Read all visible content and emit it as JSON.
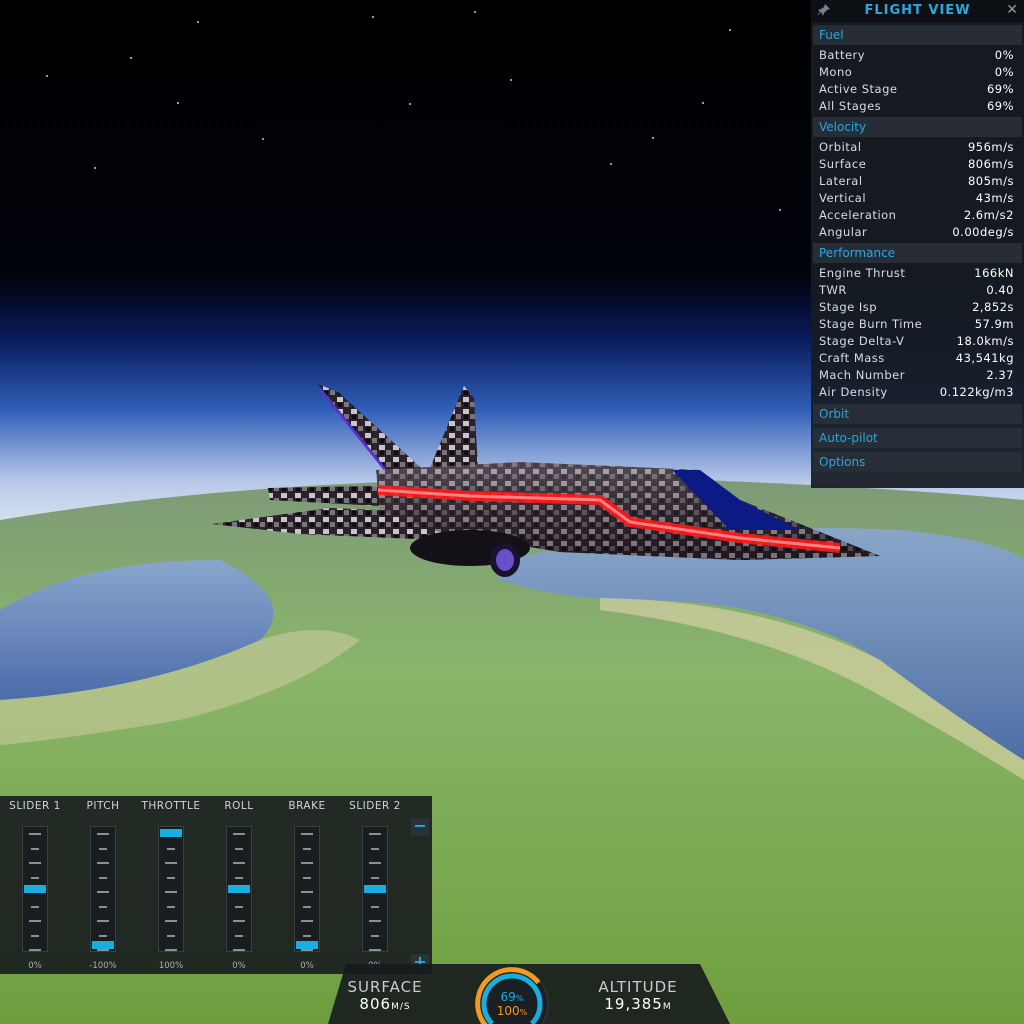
{
  "flight_view": {
    "title": "FLIGHT VIEW",
    "sections": {
      "fuel": {
        "label": "Fuel",
        "rows": [
          {
            "label": "Battery",
            "value": "0%"
          },
          {
            "label": "Mono",
            "value": "0%"
          },
          {
            "label": "Active Stage",
            "value": "69%"
          },
          {
            "label": "All Stages",
            "value": "69%"
          }
        ]
      },
      "velocity": {
        "label": "Velocity",
        "rows": [
          {
            "label": "Orbital",
            "value": "956m/s"
          },
          {
            "label": "Surface",
            "value": "806m/s"
          },
          {
            "label": "Lateral",
            "value": "805m/s"
          },
          {
            "label": "Vertical",
            "value": "43m/s"
          },
          {
            "label": "Acceleration",
            "value": "2.6m/s2"
          },
          {
            "label": "Angular",
            "value": "0.00deg/s"
          }
        ]
      },
      "performance": {
        "label": "Performance",
        "rows": [
          {
            "label": "Engine Thrust",
            "value": "166kN"
          },
          {
            "label": "TWR",
            "value": "0.40"
          },
          {
            "label": "Stage Isp",
            "value": "2,852s"
          },
          {
            "label": "Stage Burn Time",
            "value": "57.9m"
          },
          {
            "label": "Stage Delta-V",
            "value": "18.0km/s"
          },
          {
            "label": "Craft Mass",
            "value": "43,541kg"
          },
          {
            "label": "Mach Number",
            "value": "2.37"
          },
          {
            "label": "Air Density",
            "value": "0.122kg/m3"
          }
        ]
      },
      "orbit": {
        "label": "Orbit"
      },
      "autopilot": {
        "label": "Auto-pilot"
      },
      "options": {
        "label": "Options"
      }
    }
  },
  "sliders": [
    {
      "label": "SLIDER 1",
      "value": "0%",
      "level": 0.5
    },
    {
      "label": "PITCH",
      "value": "-100%",
      "level": 0.0
    },
    {
      "label": "THROTTLE",
      "value": "100%",
      "level": 1.0
    },
    {
      "label": "ROLL",
      "value": "0%",
      "level": 0.5
    },
    {
      "label": "BRAKE",
      "value": "0%",
      "level": 0.0
    },
    {
      "label": "SLIDER 2",
      "value": "0%",
      "level": 0.5
    }
  ],
  "slider_buttons": {
    "minus": "−",
    "plus": "+"
  },
  "hud": {
    "surface_label": "SURFACE",
    "surface_value": "806",
    "surface_unit": "M/S",
    "fuel_pct": "69",
    "throttle_pct": "100",
    "pct_sign": "%",
    "altitude_label": "ALTITUDE",
    "altitude_value": "19,385",
    "altitude_unit": "M",
    "fuel_level": 0.69,
    "throttle_level": 1.0
  },
  "colors": {
    "accent": "#19aee0",
    "gauge_orange": "#f39a1e",
    "glow": "#ff1a1a"
  }
}
